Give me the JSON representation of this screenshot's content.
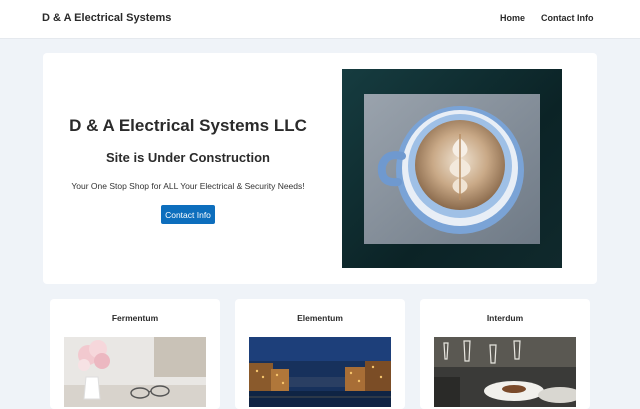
{
  "header": {
    "brand": "D & A Electrical Systems",
    "nav": {
      "home": "Home",
      "contact": "Contact Info"
    }
  },
  "hero": {
    "title": "D & A Electrical Systems LLC",
    "subtitle": "Site is Under Construction",
    "tagline": "Your One Stop Shop for ALL Your Electrical & Security Needs!",
    "button": "Contact Info",
    "image_icon": "latte-art-coffee-photo"
  },
  "cards": [
    {
      "title": "Fermentum",
      "image_icon": "flowers-glasses-photo"
    },
    {
      "title": "Elementum",
      "image_icon": "night-city-canal-photo"
    },
    {
      "title": "Interdum",
      "image_icon": "restaurant-table-photo"
    }
  ],
  "colors": {
    "page_bg": "#eff3f8",
    "accent": "#0d6ebd"
  }
}
